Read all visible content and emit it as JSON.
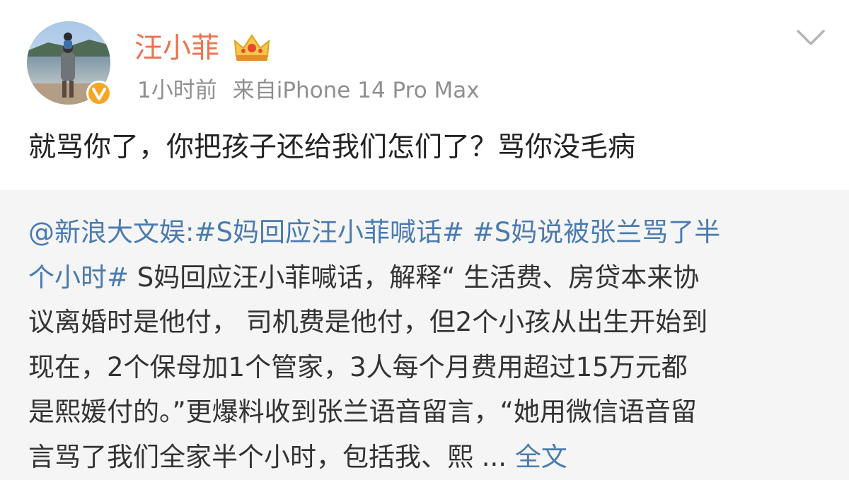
{
  "user": {
    "name": "汪小菲",
    "time": "1小时前",
    "source": "来自iPhone 14 Pro Max",
    "avatar_icon": "avatar-photo",
    "badge_icon": "verified-v-icon",
    "level_icon": "crown-icon"
  },
  "post": {
    "text": "就骂你了，你把孩子还给我们怎们了？骂你没毛病"
  },
  "repost": {
    "author_mention": "@新浪大文娱",
    "colon": ":",
    "hashtag1": "#S妈回应汪小菲喊话#",
    "hashtag2_part1": "#S妈说被张兰骂了半",
    "hashtag2_part2": "个小时#",
    "line2_rest": " S妈回应汪小菲喊话，解释“ 生活费、房贷本来协",
    "line3": "议离婚时是他付， 司机费是他付，但2个小孩从出生开始到",
    "line4": "现在，2个保母加1个管家，3人每个月费用超过15万元都",
    "line5": "是熙媛付的。”更爆料收到张兰语音留言，“她用微信语音留",
    "line6": "言骂了我们全家半个小时，包括我、熙 ... ",
    "full_text_link": "全文"
  },
  "colors": {
    "username": "#eb7350",
    "meta": "#8f8f8f",
    "link": "#4a7bb0",
    "repost_bg": "#f5f5f5",
    "badge": "#f5a623"
  }
}
